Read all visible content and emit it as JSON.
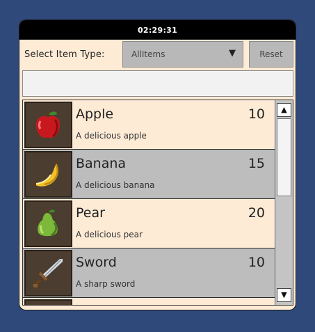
{
  "titlebar": {
    "time": "02:29:31"
  },
  "filter": {
    "label": "Select Item Type:",
    "selected": "AllItems",
    "arrow": "▼",
    "reset_label": "Reset"
  },
  "search": {
    "value": ""
  },
  "items": [
    {
      "name": "Apple",
      "count": "10",
      "description": "A delicious apple",
      "icon": "apple-icon"
    },
    {
      "name": "Banana",
      "count": "15",
      "description": "A delicious banana",
      "icon": "banana-icon"
    },
    {
      "name": "Pear",
      "count": "20",
      "description": "A delicious pear",
      "icon": "pear-icon"
    },
    {
      "name": "Sword",
      "count": "10",
      "description": "A sharp sword",
      "icon": "sword-icon"
    }
  ],
  "scrollbar": {
    "up_arrow": "▲",
    "down_arrow": "▼",
    "position_fraction": 0.0
  },
  "colors": {
    "background": "#2f4a7a",
    "panel": "#fdebd6",
    "row_alt": "#bdbdbd",
    "thumb_bg": "#4b3d30"
  }
}
